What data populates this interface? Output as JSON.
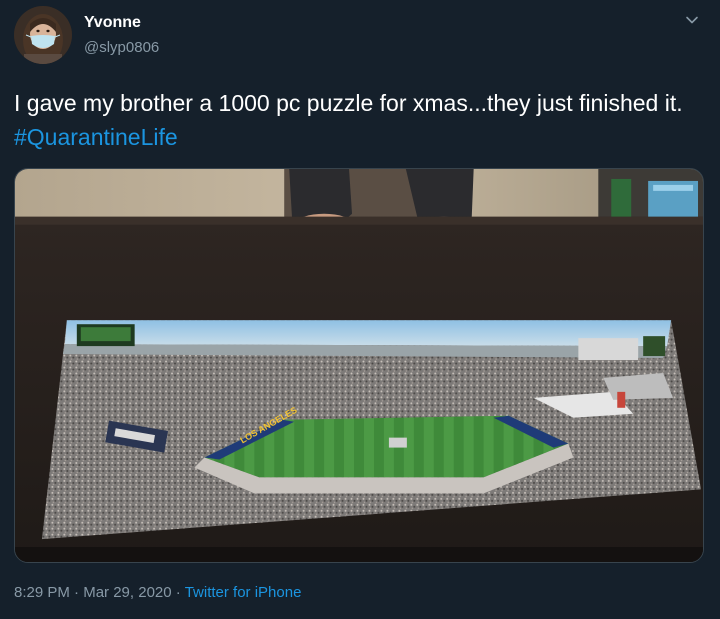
{
  "user": {
    "name": "Yvonne",
    "handle": "@slyp0806"
  },
  "tweet": {
    "text": "I gave my brother a 1000 pc puzzle for xmas...they just finished it.",
    "hashtag": "#QuarantineLife"
  },
  "meta": {
    "time": "8:29 PM",
    "separator": "·",
    "date": "Mar 29, 2020",
    "source": "Twitter for iPhone"
  },
  "media": {
    "end_zone_text": "LOS ANGELES"
  },
  "icons": {
    "avatar": "avatar-face-mask",
    "menu": "chevron-down-icon"
  },
  "colors": {
    "background": "#15202b",
    "primary_text": "#ffffff",
    "secondary_text": "#8899a6",
    "link": "#1b95e0"
  }
}
